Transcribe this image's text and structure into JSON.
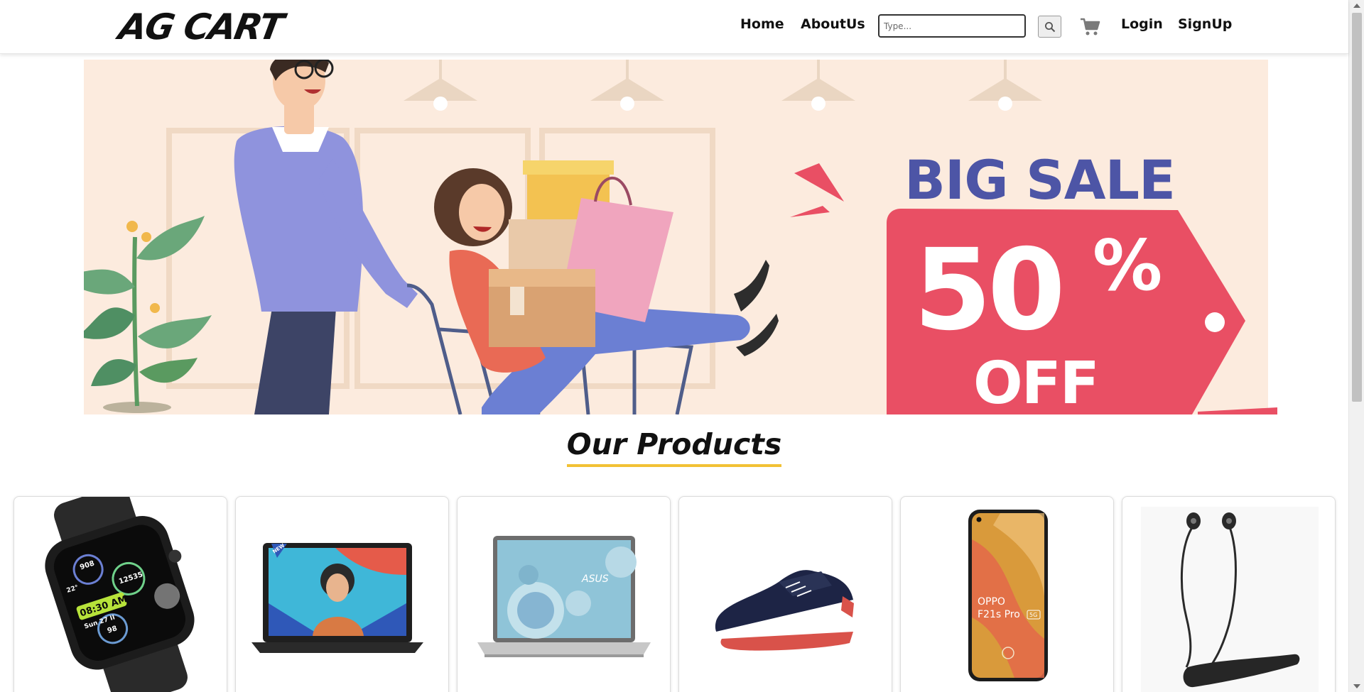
{
  "brand": {
    "logo_text": "AG CART"
  },
  "nav": {
    "home": "Home",
    "about": "AboutUs",
    "login": "Login",
    "signup": "SignUp"
  },
  "search": {
    "placeholder": "Type...",
    "value": "",
    "icon": "search-icon"
  },
  "cart": {
    "icon": "cart-icon"
  },
  "banner": {
    "headline": "BIG SALE",
    "discount": "50",
    "percent": "%",
    "off": "OFF",
    "colors": {
      "background": "#fcebde",
      "headline": "#4d55a6",
      "tag": "#e94f64"
    }
  },
  "section": {
    "title": "Our Products",
    "underline_color": "#f2c134"
  },
  "products": [
    {
      "name": "smartwatch",
      "image_text": [
        "08:30 AM",
        "Sun 27 II",
        "12535",
        "908",
        "98",
        "22°"
      ]
    },
    {
      "name": "laptop-dell",
      "image_text": [
        "NEW"
      ]
    },
    {
      "name": "laptop-asus",
      "image_text": [
        "ASUS"
      ]
    },
    {
      "name": "running-shoe",
      "image_text": []
    },
    {
      "name": "phone-oppo",
      "image_text": [
        "OPPO",
        "F21s Pro",
        "5G"
      ]
    },
    {
      "name": "neckband-earphones",
      "image_text": []
    }
  ]
}
